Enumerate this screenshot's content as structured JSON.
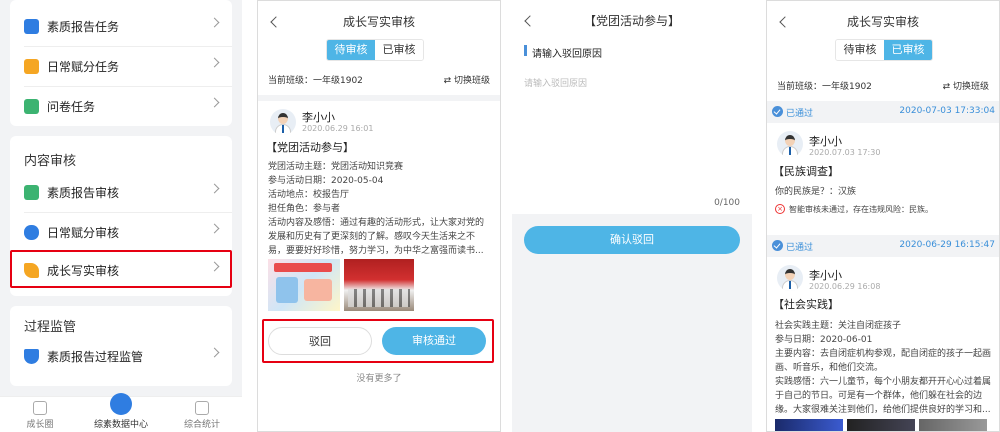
{
  "panel1": {
    "top_items": [
      {
        "label": "素质报告任务",
        "icon": "report-task-icon",
        "color": "#2f7de1"
      },
      {
        "label": "日常赋分任务",
        "icon": "score-task-icon",
        "color": "#f5a623"
      },
      {
        "label": "问卷任务",
        "icon": "questionnaire-icon",
        "color": "#3cb371"
      }
    ],
    "section1_title": "内容审核",
    "review_items": [
      {
        "label": "素质报告审核",
        "icon": "report-review-icon",
        "color": "#3cb371"
      },
      {
        "label": "日常赋分审核",
        "icon": "score-review-icon",
        "color": "#2f7de1"
      },
      {
        "label": "成长写实审核",
        "icon": "growth-review-icon",
        "color": "#f5a623"
      }
    ],
    "section2_title": "过程监管",
    "monitor_items": [
      {
        "label": "素质报告过程监管",
        "icon": "shield-icon",
        "color": "#2f7de1"
      }
    ],
    "tabs": [
      {
        "label": "成长圈",
        "icon": "growth-circle-icon"
      },
      {
        "label": "综素数据中心",
        "icon": "data-center-icon"
      },
      {
        "label": "综合统计",
        "icon": "statistics-icon"
      }
    ]
  },
  "panel2": {
    "title": "成长写实审核",
    "tab_pending": "待审核",
    "tab_approved": "已审核",
    "class_label": "当前班级：一年级1902",
    "switch_class": "切换班级",
    "user": "李小小",
    "time": "2020.06.29 16:01",
    "card_title": "【党团活动参与】",
    "lines": [
      "党团活动主题：党团活动知识竞赛",
      "参与活动日期：2020-05-04",
      "活动地点：校报告厅",
      "担任角色：参与者",
      "活动内容及感悟：通过有趣的活动形式，让大家对党的",
      "发展和历史有了更深刻的了解。感叹今天生活来之不",
      "易，要要好好珍惜，努力学习，为中华之富强而读书..."
    ],
    "reject_btn": "驳回",
    "approve_btn": "审核通过",
    "no_more": "没有更多了"
  },
  "panel3": {
    "title": "【党团活动参与】",
    "section_label": "请输入驳回原因",
    "placeholder": "请输入驳回原因",
    "counter": "0/100",
    "confirm_btn": "确认驳回"
  },
  "panel4": {
    "title": "成长写实审核",
    "tab_pending": "待审核",
    "tab_approved": "已审核",
    "class_label": "当前班级：一年级1902",
    "switch_class": "切换班级",
    "items": [
      {
        "status": "已通过",
        "datetime": "2020-07-03 17:33:04",
        "user": "李小小",
        "time": "2020.07.03 17:30",
        "title": "【民族调查】",
        "lines": [
          "你的民族是？：汉族"
        ],
        "warning": "智能审核未通过，存在违规风险：民族。"
      },
      {
        "status": "已通过",
        "datetime": "2020-06-29 16:15:47",
        "user": "李小小",
        "time": "2020.06.29 16:08",
        "title": "【社会实践】",
        "lines": [
          "社会实践主题：关注自闭症孩子",
          "参与日期：2020-06-01",
          "主要内容：去自闭症机构参观，配自闭症的孩子一起画",
          "画、听音乐，和他们交流。",
          "实践感悟：六一儿童节，每个小朋友都开开心心过着属",
          "于自己的节日。可是有一个群体，他们躲在社会的边",
          "缘。大家很难关注到他们，给他们提供良好的学习和..."
        ]
      }
    ]
  }
}
